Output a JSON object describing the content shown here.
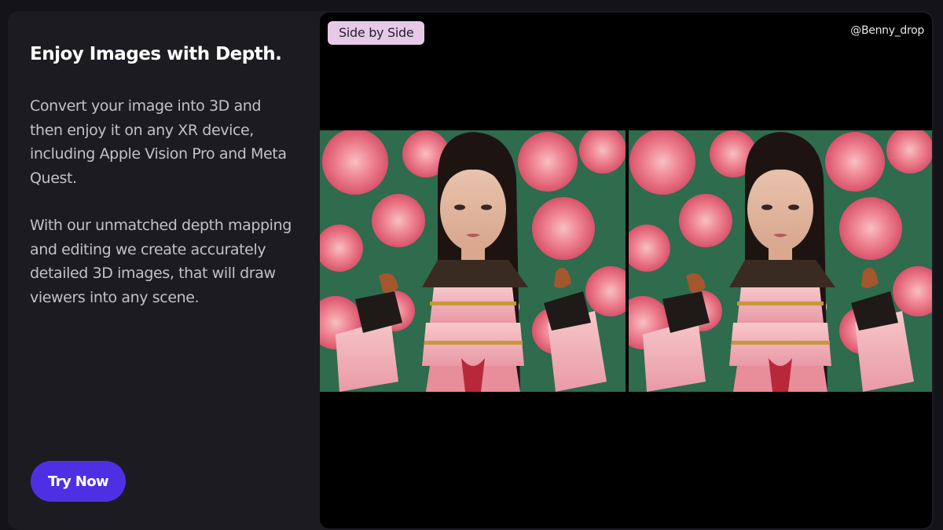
{
  "left": {
    "title": "Enjoy Images with Depth.",
    "paragraph_1": "Convert your image into 3D and then enjoy it on any XR device, including Apple Vision Pro and Meta Quest.",
    "paragraph_2": "With our unmatched depth mapping and editing we create accurately detailed 3D images, that will draw viewers into any scene.",
    "cta_label": "Try Now"
  },
  "viewer": {
    "mode_label": "Side by Side",
    "credit": "@Benny_drop"
  },
  "colors": {
    "background": "#141318",
    "card": "#1c1b22",
    "accent": "#4f2fe3",
    "badge": "#e7c9e7",
    "viewer_bg": "#000000"
  }
}
